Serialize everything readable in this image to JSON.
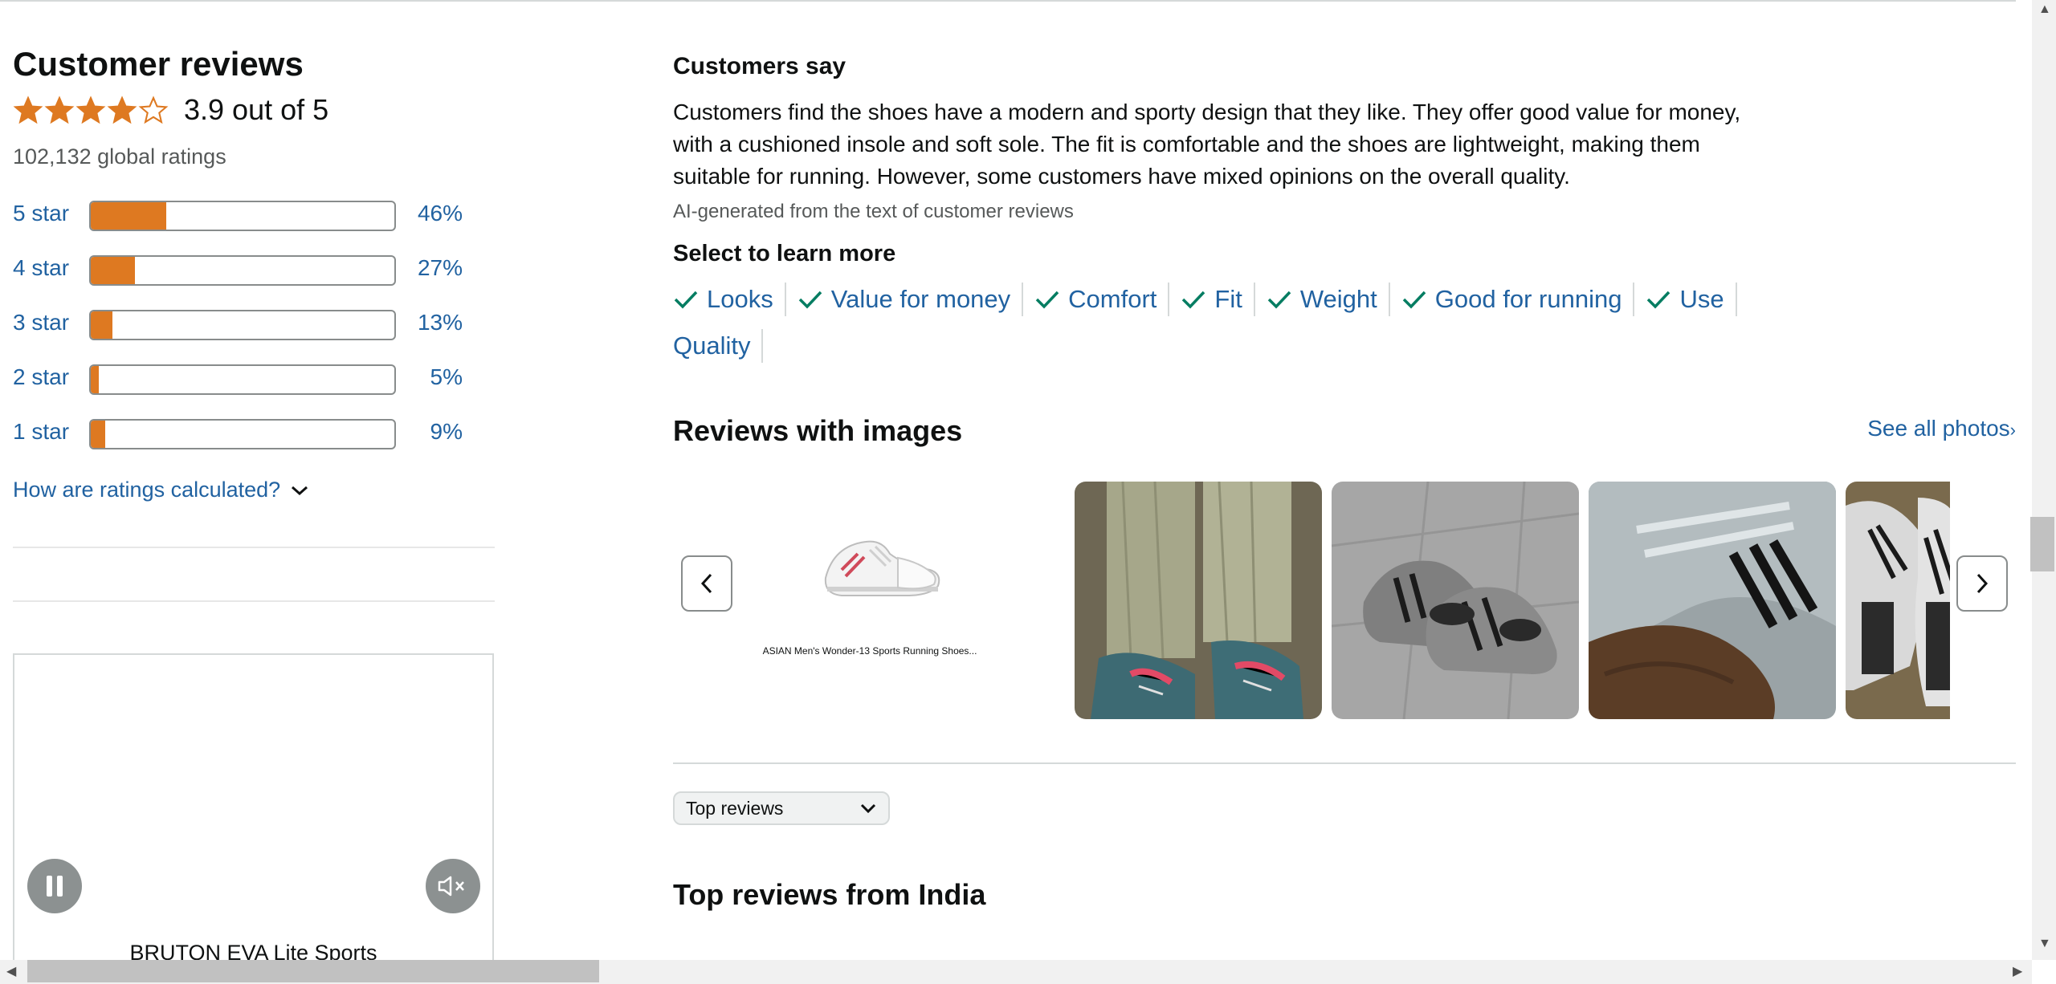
{
  "left": {
    "title": "Customer reviews",
    "rating_value": 3.9,
    "rating_text": "3.9 out of 5",
    "global_ratings": "102,132 global ratings",
    "histogram": [
      {
        "label": "5 star",
        "percent": 46,
        "percent_text": "46%"
      },
      {
        "label": "4 star",
        "percent": 27,
        "percent_text": "27%"
      },
      {
        "label": "3 star",
        "percent": 13,
        "percent_text": "13%"
      },
      {
        "label": "2 star",
        "percent": 5,
        "percent_text": "5%"
      },
      {
        "label": "1 star",
        "percent": 9,
        "percent_text": "9%"
      }
    ],
    "how_calculated": "How are ratings calculated?",
    "video_title": "BRUTON EVA Lite Sports"
  },
  "right": {
    "customers_say_title": "Customers say",
    "summary": "Customers find the shoes have a modern and sporty design that they like. They offer good value for money, with a cushioned insole and soft sole. The fit is comfortable and the shoes are lightweight, making them suitable for running. However, some customers have mixed opinions on the overall quality.",
    "ai_note": "AI-generated from the text of customer reviews",
    "select_title": "Select to learn more",
    "aspects": [
      {
        "label": "Looks",
        "checked": true
      },
      {
        "label": "Value for money",
        "checked": true
      },
      {
        "label": "Comfort",
        "checked": true
      },
      {
        "label": "Fit",
        "checked": true
      },
      {
        "label": "Weight",
        "checked": true
      },
      {
        "label": "Good for running",
        "checked": true
      },
      {
        "label": "Use",
        "checked": true
      },
      {
        "label": "Quality",
        "checked": false
      }
    ],
    "reviews_with_images_title": "Reviews with images",
    "see_all_photos": "See all photos",
    "first_card_caption": "ASIAN Men's Wonder-13 Sports Running Shoes...",
    "sort_selected": "Top reviews",
    "top_reviews_title": "Top reviews from India"
  },
  "colors": {
    "star": "#de7921",
    "link": "#2162a1",
    "check": "#067d62"
  }
}
